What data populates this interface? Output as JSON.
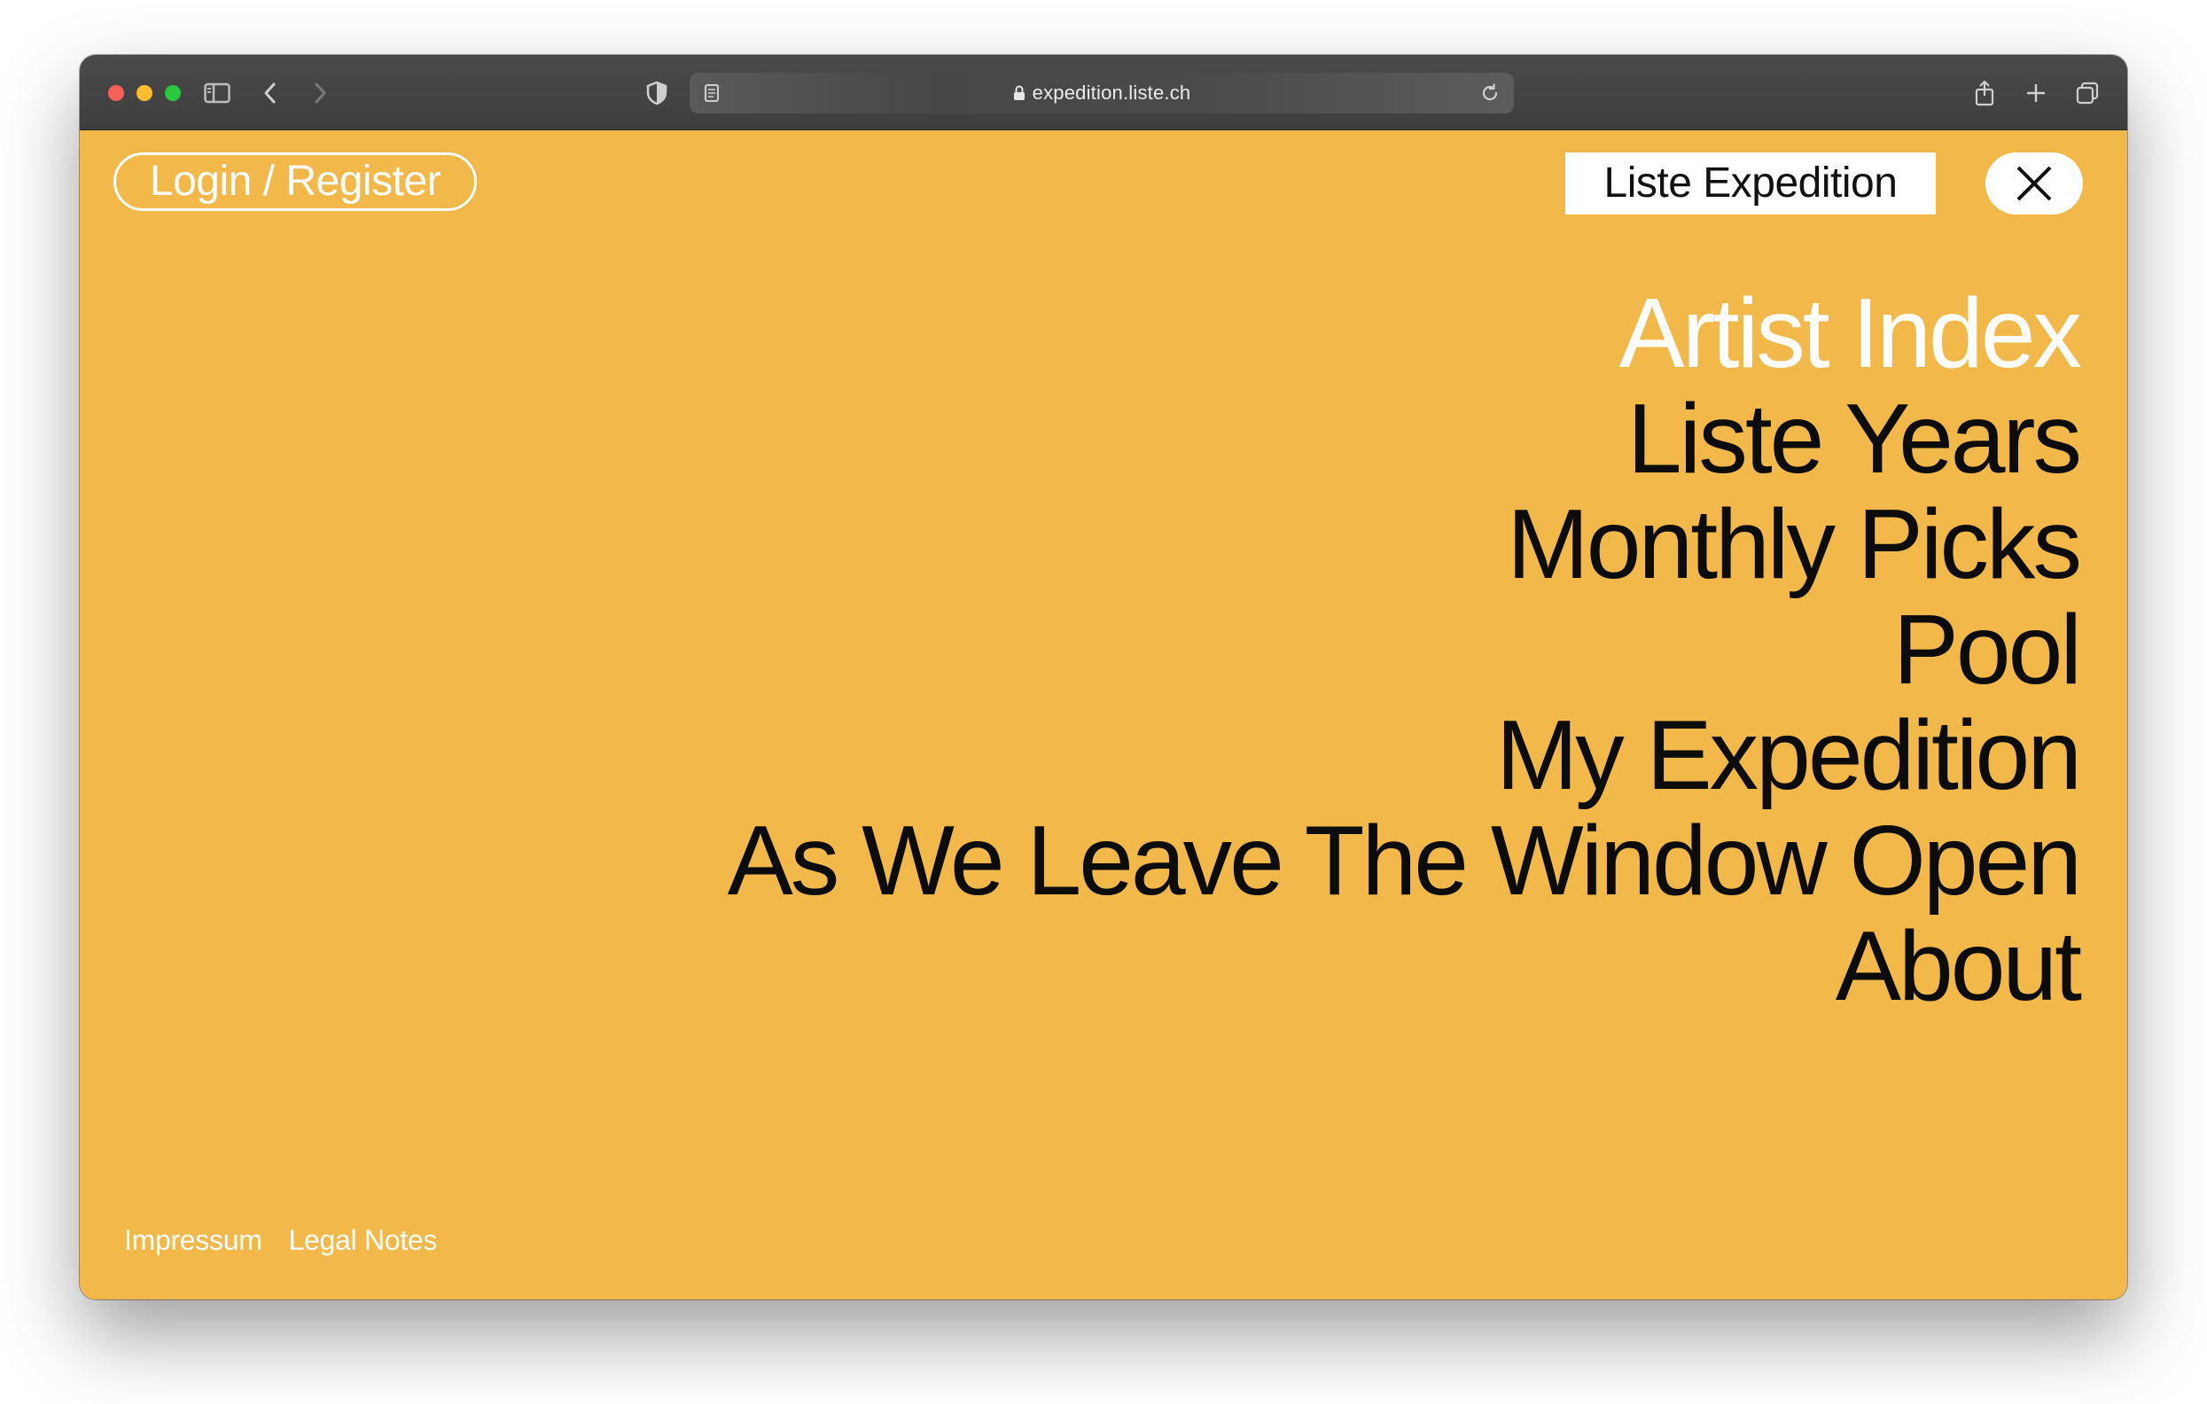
{
  "browser": {
    "url": "expedition.liste.ch",
    "icons": {
      "sidebar": "sidebar-icon",
      "back": "chevron-left-icon",
      "forward": "chevron-right-icon",
      "privacy": "shield-icon",
      "reader": "reader-icon",
      "lock": "lock-icon",
      "reload": "reload-icon",
      "share": "share-icon",
      "new_tab": "plus-icon",
      "tabs": "tabs-overview-icon"
    }
  },
  "header": {
    "login_label": "Login / Register",
    "brand_label": "Liste Expedition",
    "close_icon": "close-icon"
  },
  "menu": {
    "items": [
      {
        "label": "Artist Index",
        "active": true
      },
      {
        "label": "Liste Years",
        "active": false
      },
      {
        "label": "Monthly Picks",
        "active": false
      },
      {
        "label": "Pool",
        "active": false
      },
      {
        "label": "My Expedition",
        "active": false
      },
      {
        "label": "As We Leave The Window Open",
        "active": false
      },
      {
        "label": "About",
        "active": false
      }
    ]
  },
  "footer": {
    "links": [
      "Impressum",
      "Legal Notes"
    ]
  },
  "colors": {
    "background": "#F3B84A",
    "active_item": "#FFFFFF",
    "menu_text": "#0C0C0C",
    "toolbar": "#3E3E3E"
  }
}
